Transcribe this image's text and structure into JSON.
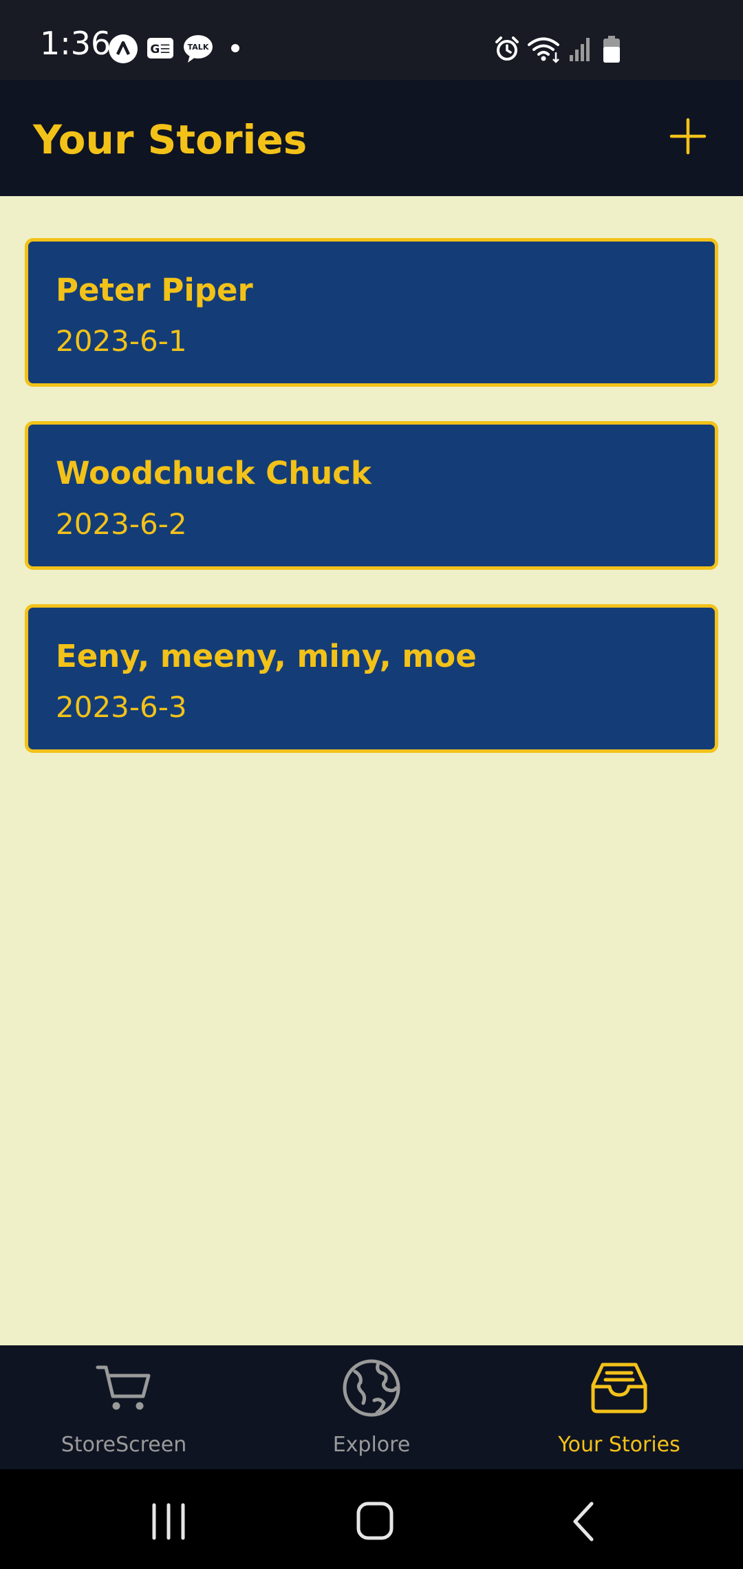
{
  "status_bar": {
    "time": "1:36",
    "left_icons": [
      "app-a-icon",
      "ge-icon",
      "talk-icon",
      "notification-dot-icon"
    ],
    "right_icons": [
      "alarm-icon",
      "wifi-icon",
      "signal-icon",
      "battery-icon"
    ],
    "talk_label": "TALK",
    "ge_label": "G☰"
  },
  "header": {
    "title": "Your Stories",
    "add_icon": "plus-icon"
  },
  "stories": [
    {
      "title": "Peter Piper",
      "date": "2023-6-1"
    },
    {
      "title": "Woodchuck Chuck",
      "date": "2023-6-2"
    },
    {
      "title": "Eeny, meeny, miny, moe",
      "date": "2023-6-3"
    }
  ],
  "tabs": [
    {
      "label": "StoreScreen",
      "icon": "cart-icon",
      "active": false
    },
    {
      "label": "Explore",
      "icon": "globe-icon",
      "active": false
    },
    {
      "label": "Your Stories",
      "icon": "inbox-icon",
      "active": true
    }
  ],
  "colors": {
    "accent": "#F3C219",
    "header_bg": "#0F1422",
    "content_bg": "#EFF0C8",
    "card_bg": "#143D77",
    "inactive_tab": "#9A9A9A"
  },
  "system_nav": [
    "recent-apps-icon",
    "home-icon",
    "back-icon"
  ]
}
